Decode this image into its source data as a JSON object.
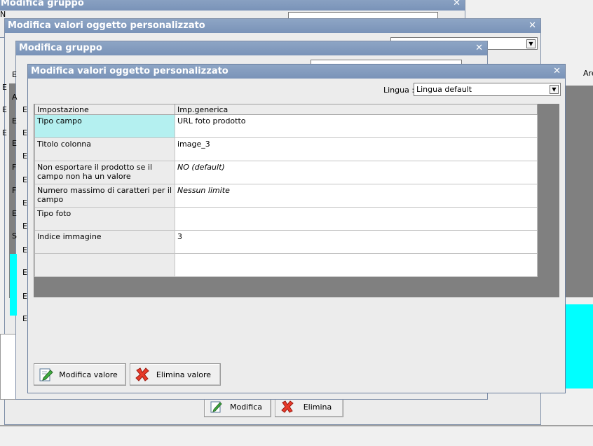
{
  "bg_windows": {
    "win1_title": "Modifica gruppo",
    "win2_title": "Modifica valori oggetto personalizzato",
    "win3_title": "Modifica gruppo",
    "right_label": "Are",
    "modifica_label": "Modifica",
    "elimina_label": "Elimina"
  },
  "dialog": {
    "title": "Modifica valori oggetto personalizzato",
    "lingua_label": "Lingua :",
    "lingua_value": "Lingua default",
    "table": {
      "headers": [
        "Impostazione",
        "Imp.generica"
      ],
      "rows": [
        {
          "key": "Tipo campo",
          "value": "URL foto prodotto",
          "selected": true,
          "italic": false
        },
        {
          "key": "Titolo colonna",
          "value": "image_3",
          "selected": false,
          "italic": false
        },
        {
          "key": "Non esportare il prodotto se il campo non ha un valore",
          "value": "NO (default)",
          "selected": false,
          "italic": true
        },
        {
          "key": "Numero massimo di caratteri per il campo",
          "value": "Nessun limite",
          "selected": false,
          "italic": true
        },
        {
          "key": "Tipo foto",
          "value": "",
          "selected": false,
          "italic": false
        },
        {
          "key": "Indice immagine",
          "value": "3",
          "selected": false,
          "italic": false
        },
        {
          "key": "",
          "value": "",
          "selected": false,
          "italic": false
        }
      ]
    },
    "modifica_valore_label": "Modifica valore",
    "elimina_valore_label": "Elimina valore"
  },
  "icons": {
    "close": "close-icon",
    "dropdown": "chevron-down-icon",
    "edit": "edit-pencil-icon",
    "delete": "red-x-icon"
  },
  "colors": {
    "title_bar": "#7a93b8",
    "selected_row": "#b4f0f0",
    "cyan_panel": "#00ffff",
    "gray_panel": "#808080"
  }
}
